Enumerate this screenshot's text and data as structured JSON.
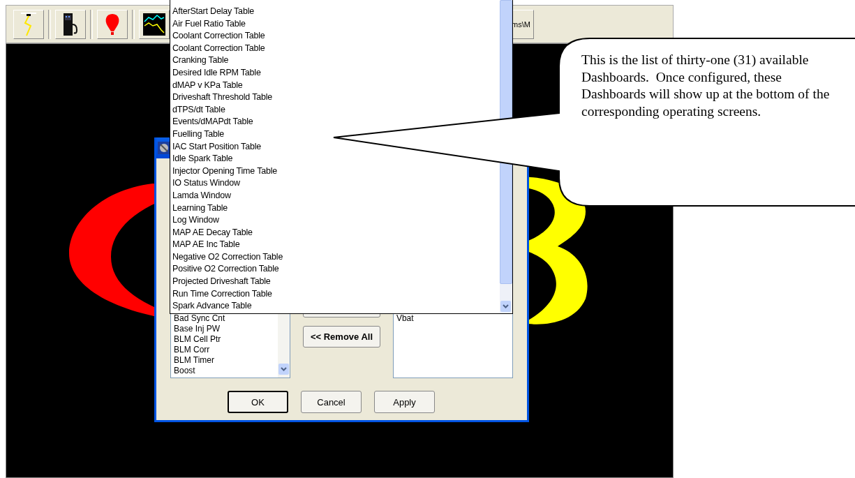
{
  "toolbar": {
    "buttons": [
      {
        "kind": "lightning"
      },
      {
        "kind": "fuel"
      },
      {
        "kind": "balloon"
      },
      {
        "kind": "graph"
      }
    ],
    "partial_button": "ms\\M"
  },
  "dialog": {
    "source_list": [
      "Bad Sync Cnt",
      "Base Inj PW",
      "BLM Cell Ptr",
      "BLM Corr",
      "BLM Timer",
      "Boost"
    ],
    "selected_list": [
      "Vbat"
    ],
    "remove_all_button": "<< Remove All",
    "footer_buttons": [
      {
        "label": "OK",
        "default": true
      },
      {
        "label": "Cancel",
        "default": false
      },
      {
        "label": "Apply",
        "default": false
      }
    ]
  },
  "dropdown": {
    "items": [
      "AfterStart Delay Table",
      "Air Fuel Ratio Table",
      "Coolant Correction Table",
      "Coolant Correction Table",
      "Cranking Table",
      "Desired Idle RPM Table",
      "dMAP v KPa Table",
      "Driveshaft Threshold Table",
      "dTPS/dt Table",
      "Events/dMAPdt Table",
      "Fuelling Table",
      "IAC Start Position Table",
      "Idle Spark Table",
      "Injector Opening Time Table",
      "IO Status Window",
      "Lamda Window",
      "Learning Table",
      "Log Window",
      "MAP AE Decay Table",
      "MAP AE Inc Table",
      "Negative O2 Correction Table",
      "Positive O2 Correction Table",
      "Projected Driveshaft Table",
      "Run Time Correction Table",
      "Spark Advance Table"
    ]
  },
  "callout": {
    "text": "This is the list of thirty-one (31) available Dashboards.  Once configured, these Dashboards will show up at the bottom of the corresponding operating screens."
  }
}
